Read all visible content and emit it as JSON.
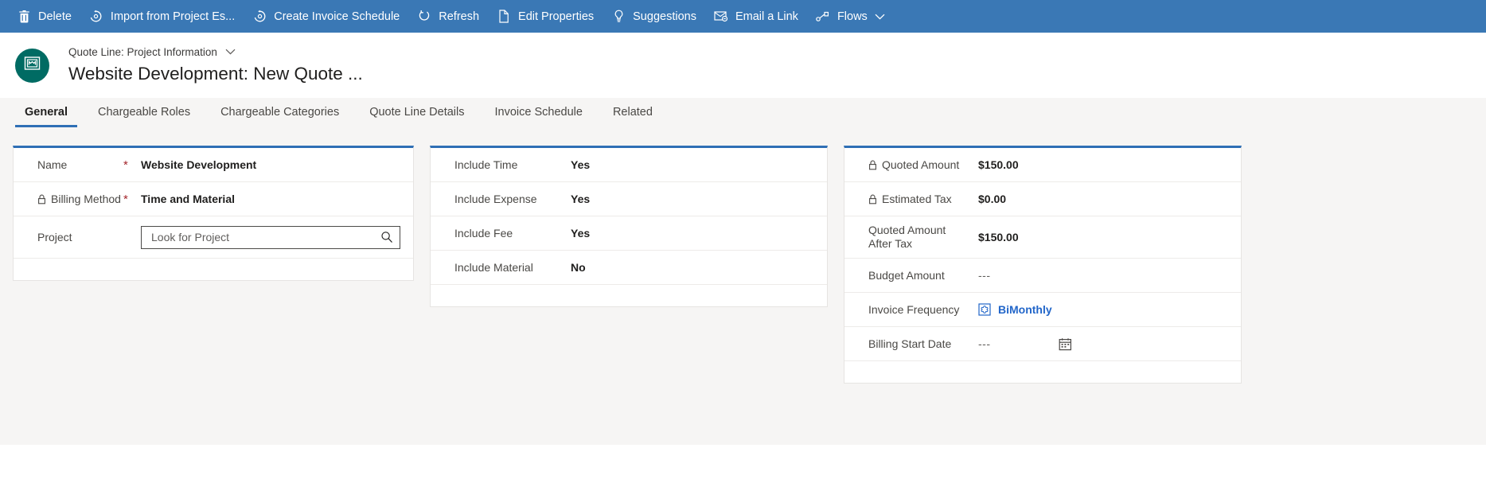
{
  "command_bar": {
    "background": "#3a78b5",
    "buttons": [
      {
        "label": "Delete",
        "icon": "trash-icon"
      },
      {
        "label": "Import from Project Es...",
        "icon": "refresh-gear-icon"
      },
      {
        "label": "Create Invoice Schedule",
        "icon": "refresh-gear-icon"
      },
      {
        "label": "Refresh",
        "icon": "refresh-icon"
      },
      {
        "label": "Edit Properties",
        "icon": "page-edit-icon"
      },
      {
        "label": "Suggestions",
        "icon": "lightbulb-icon"
      },
      {
        "label": "Email a Link",
        "icon": "email-link-icon"
      },
      {
        "label": "Flows",
        "icon": "flows-icon",
        "caret": true
      }
    ]
  },
  "header": {
    "avatar_icon": "quote-line-entity-icon",
    "avatar_color": "#006b63",
    "subtitle": "Quote Line: Project Information",
    "title": "Website Development: New Quote ..."
  },
  "tabs": [
    {
      "label": "General",
      "active": true
    },
    {
      "label": "Chargeable Roles",
      "active": false
    },
    {
      "label": "Chargeable Categories",
      "active": false
    },
    {
      "label": "Quote Line Details",
      "active": false
    },
    {
      "label": "Invoice Schedule",
      "active": false
    },
    {
      "label": "Related",
      "active": false
    }
  ],
  "general_card": {
    "accent": "#2f6fb5",
    "name": {
      "label": "Name",
      "required": "*",
      "value": "Website Development"
    },
    "billing_method": {
      "label": "Billing Method",
      "required": "*",
      "value": "Time and Material",
      "locked": true
    },
    "project": {
      "label": "Project",
      "placeholder": "Look for Project",
      "value": ""
    }
  },
  "include_card": {
    "rows": [
      {
        "label": "Include Time",
        "value": "Yes"
      },
      {
        "label": "Include Expense",
        "value": "Yes"
      },
      {
        "label": "Include Fee",
        "value": "Yes"
      },
      {
        "label": "Include Material",
        "value": "No"
      }
    ]
  },
  "amounts_card": {
    "quoted_amount": {
      "label": "Quoted Amount",
      "value": "$150.00",
      "locked": true
    },
    "estimated_tax": {
      "label": "Estimated Tax",
      "value": "$0.00",
      "locked": true
    },
    "quoted_after_tax": {
      "label_line1": "Quoted Amount",
      "label_line2": "After Tax",
      "value": "$150.00"
    },
    "budget_amount": {
      "label": "Budget Amount",
      "value": "---"
    },
    "invoice_frequency": {
      "label": "Invoice Frequency",
      "value": "BiMonthly",
      "link_color": "#2266c9",
      "icon": "invoice-frequency-icon"
    },
    "billing_start_date": {
      "label": "Billing Start Date",
      "value": "---",
      "icon": "calendar-icon"
    }
  }
}
